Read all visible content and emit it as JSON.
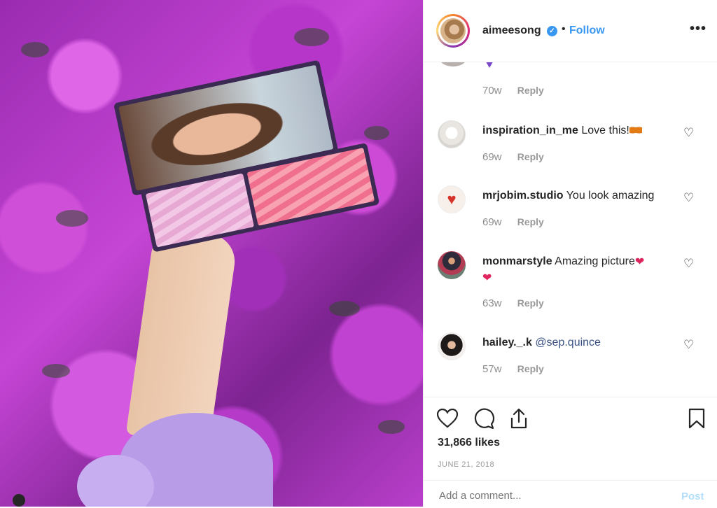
{
  "header": {
    "username": "aimeesong",
    "verified_mark": "✓",
    "separator": "•",
    "follow_label": "Follow",
    "more_label": "•••"
  },
  "comments_top": {
    "age": "70w",
    "reply_label": "Reply"
  },
  "comments": [
    {
      "user": "inspiration_in_me",
      "text": "Love this!",
      "emoji": "butterfly",
      "age": "69w",
      "reply_label": "Reply"
    },
    {
      "user": "mrjobim.studio",
      "text": "You look amazing",
      "age": "69w",
      "reply_label": "Reply"
    },
    {
      "user": "monmarstyle",
      "text": "Amazing picture",
      "emoji": "hearts",
      "age": "63w",
      "reply_label": "Reply"
    },
    {
      "user": "hailey._.k",
      "text": "@sep.quince",
      "age": "57w",
      "reply_label": "Reply"
    }
  ],
  "actions": {
    "icons": [
      "heart-icon",
      "comment-icon",
      "share-icon",
      "bookmark-icon"
    ],
    "likes": "31,866 likes",
    "date": "JUNE 21, 2018"
  },
  "add_comment": {
    "placeholder": "Add a comment...",
    "post_label": "Post"
  },
  "colors": {
    "accent": "#3897f0",
    "post_disabled": "#b2dffc",
    "muted_text": "#8e8e8e"
  }
}
